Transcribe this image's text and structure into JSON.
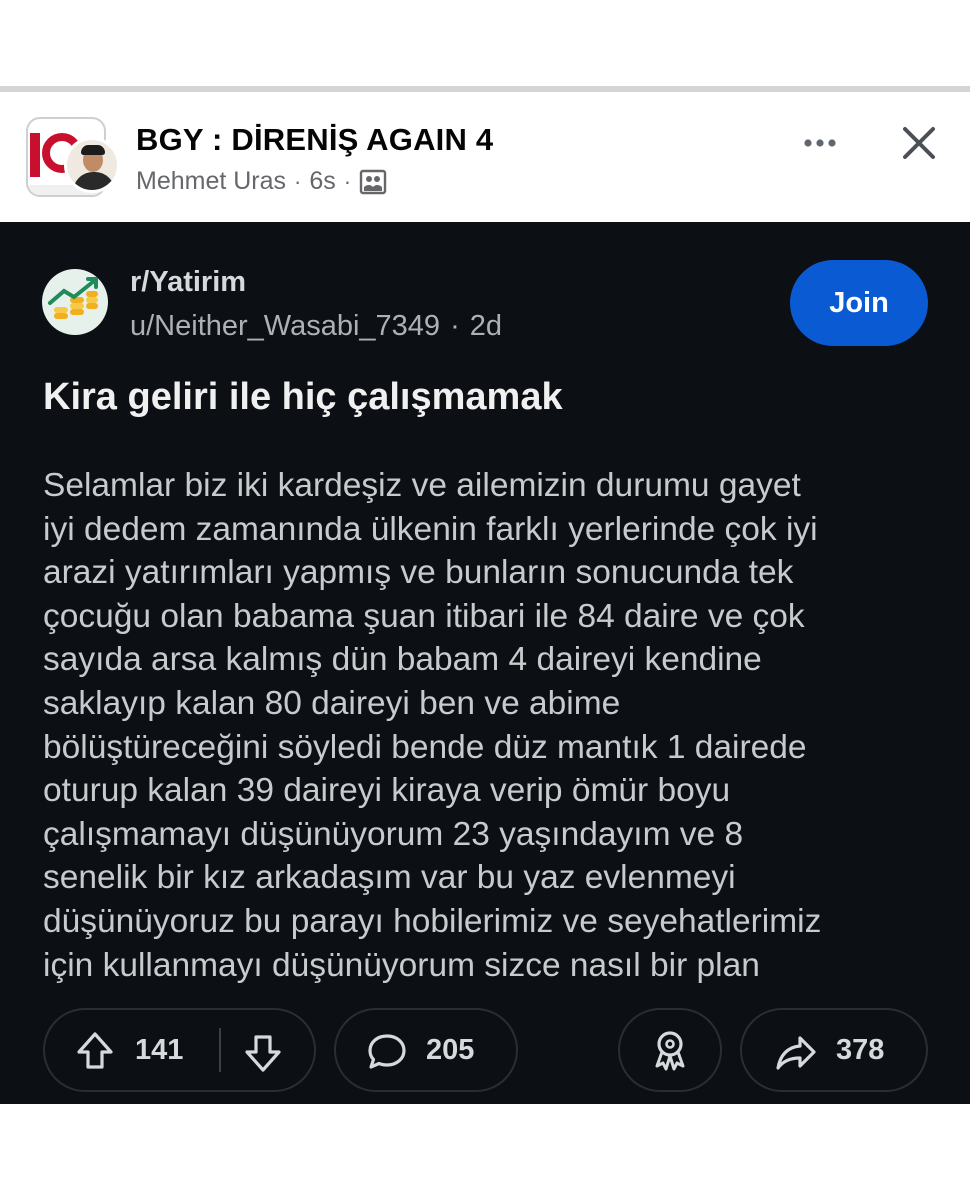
{
  "story": {
    "title": "BGY : DİRENİŞ AGAIN 4",
    "author": "Mehmet Uras",
    "time": "6s",
    "separator": "·",
    "icons": [
      "page-logo",
      "user-avatar",
      "gallery-icon",
      "more-icon",
      "close-icon"
    ]
  },
  "post": {
    "subreddit": "r/Yatirim",
    "username": "u/Neither_Wasabi_7349",
    "separator": "·",
    "age": "2d",
    "join_label": "Join",
    "title": "Kira geliri ile hiç çalışmamak",
    "body_lines": [
      "Selamlar biz iki kardeşiz ve ailemizin durumu gayet",
      "iyi dedem zamanında ülkenin farklı yerlerinde çok iyi",
      "arazi yatırımları yapmış ve bunların sonucunda tek",
      "çocuğu olan babama şuan itibari ile 84 daire ve çok",
      "sayıda arsa kalmış dün babam 4 daireyi kendine",
      "saklayıp kalan 80 daireyi ben ve abime",
      "bölüştüreceğini söyledi bende düz mantık 1 dairede",
      "oturup kalan 39 daireyi kiraya verip ömür boyu",
      "çalışmamayı düşünüyorum 23 yaşındayım ve 8",
      "senelik bir kız arkadaşım var bu yaz evlenmeyi",
      "düşünüyoruz bu parayı hobilerimiz ve seyehatlerimiz",
      "için kullanmayı düşünüyorum sizce nasıl bir plan"
    ],
    "actions": {
      "upvotes": "141",
      "comments": "205",
      "shares": "378"
    }
  },
  "colors": {
    "card_bg": "#0c0f13",
    "join_blue": "#0a5bd3",
    "text_light": "#d7dadc",
    "meta_grey": "#65676b"
  }
}
